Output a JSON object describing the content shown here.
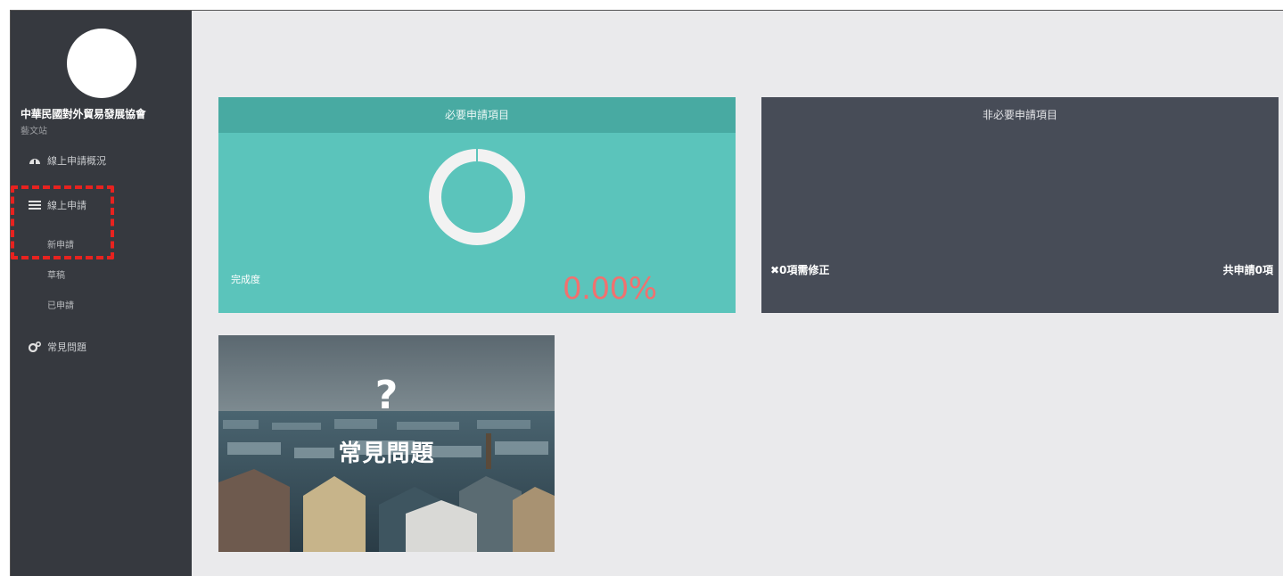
{
  "sidebar": {
    "org_name": "中華民國對外貿易發展協會",
    "org_sub": "藝文站",
    "items": [
      {
        "label": "線上申請概況",
        "icon": "dashboard-icon"
      },
      {
        "label": "線上申請",
        "icon": "list-icon"
      },
      {
        "label": "常見問題",
        "icon": "gears-icon"
      }
    ],
    "sub_items": [
      "新申請",
      "草稿",
      "已申請"
    ]
  },
  "required_card": {
    "title": "必要申請項目",
    "progress_label": "完成度",
    "progress_value": "0.00%",
    "progress_fraction": 0
  },
  "optional_card": {
    "title": "非必要申請項目",
    "fix_count": "✖0項需修正",
    "total_count": "共申請0項"
  },
  "faq_card": {
    "question_mark": "?",
    "title": "常見問題"
  },
  "colors": {
    "sidebar_bg": "#36393f",
    "teal": "#5bc4bb",
    "teal_header": "#48aaa2",
    "slate": "#474c57",
    "progress_red": "#f0716f",
    "highlight_red": "#e8221f"
  }
}
